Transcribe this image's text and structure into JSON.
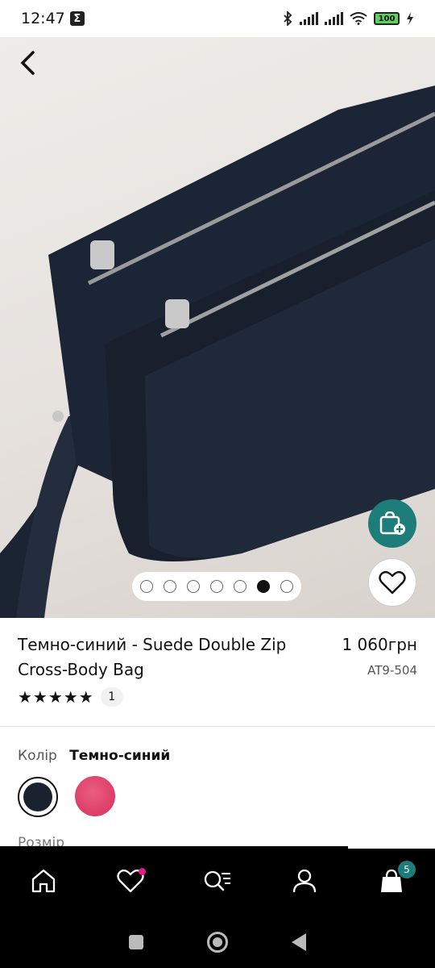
{
  "status_bar": {
    "time": "12:47",
    "sigma_glyph": "Σ",
    "battery_level": "100",
    "icons": [
      "bluetooth-icon",
      "signal-icon",
      "signal-icon",
      "wifi-icon",
      "battery-icon",
      "charging-icon"
    ]
  },
  "gallery": {
    "image_count": 7,
    "active_index": 5,
    "image_alt": "Product photo of a dark navy suede double zip cross-body bag"
  },
  "product": {
    "title": "Темно-синий - Suede Double Zip Cross-Body Bag",
    "price": "1 060грн",
    "sku": "AT9-504",
    "stars": "★★★★★",
    "rating_value": 5,
    "review_count": "1"
  },
  "color": {
    "label": "Колір",
    "selected_value": "Темно-синий",
    "swatches": [
      {
        "name": "Темно-синий",
        "hex": "#1a2230",
        "selected": true
      },
      {
        "name": "pink",
        "hex": "#e0406b",
        "selected": false
      }
    ]
  },
  "size": {
    "label": "Розмір"
  },
  "bottom_nav": {
    "items": [
      "home-icon",
      "heart-icon",
      "search-icon",
      "profile-icon",
      "cart-icon"
    ],
    "cart_count": "5"
  },
  "colors": {
    "accent_teal": "#1d7d7a",
    "wishlist_dot": "#e7198a",
    "nav_background": "#000000"
  }
}
